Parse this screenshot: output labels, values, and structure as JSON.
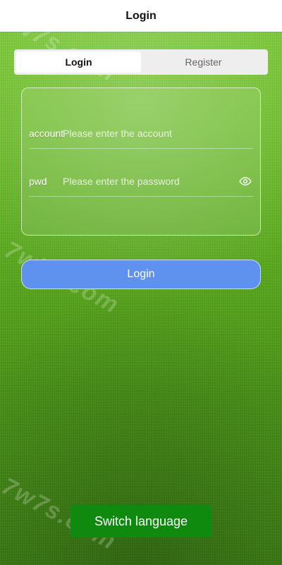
{
  "header": {
    "title": "Login"
  },
  "tabs": [
    {
      "label": "Login",
      "active": true
    },
    {
      "label": "Register",
      "active": false
    }
  ],
  "form": {
    "account": {
      "label": "account",
      "placeholder": "Please enter the account",
      "value": ""
    },
    "pwd": {
      "label": "pwd",
      "placeholder": "Please enter the password",
      "value": "",
      "toggle_icon": "eye-icon"
    }
  },
  "actions": {
    "login_label": "Login",
    "switch_language_label": "Switch language"
  },
  "watermark": {
    "text": "7w7s.com"
  },
  "colors": {
    "header_bg": "#ffffff",
    "login_button": "#5f91ef",
    "switch_language_button": "#0f8a0f"
  }
}
